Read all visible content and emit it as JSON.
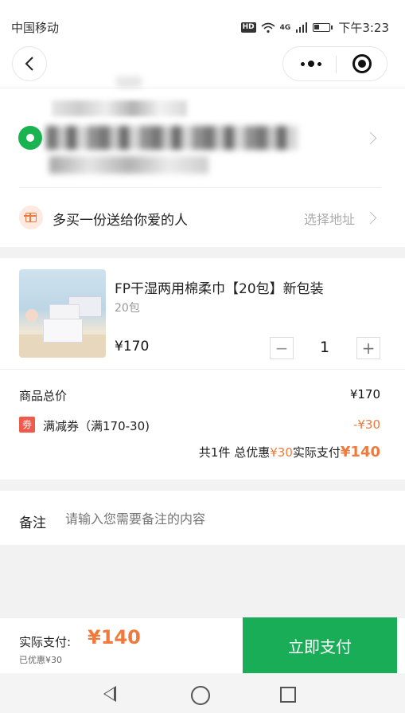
{
  "status_bar": {
    "carrier": "中国移动",
    "network": "4G",
    "hd": "HD",
    "time": "下午3:23"
  },
  "nav": {
    "back_icon": "chevron-left-icon",
    "more_icon": "more-dots-icon",
    "close_icon": "target-circle-icon"
  },
  "address": {
    "icon": "location-pin-icon",
    "color": "#19b350"
  },
  "gift": {
    "icon": "gift-icon",
    "text": "多买一份送给你爱的人",
    "action": "选择地址"
  },
  "product": {
    "title": "FP干湿两用棉柔巾【20包】新包装",
    "spec": "20包",
    "price": "¥170",
    "quantity": "1",
    "minus": "−",
    "plus": "+"
  },
  "totals": {
    "goods_label": "商品总价",
    "goods_value": "¥170",
    "coupon_badge": "劵",
    "coupon_label": "满减券（满170-30)",
    "coupon_value": "-¥30",
    "summary_prefix": "共1件 总优惠 ",
    "summary_discount": "¥30",
    "summary_mid": " 实际支付",
    "summary_total": "¥140"
  },
  "note": {
    "label": "备注",
    "placeholder": "请输入您需要备注的内容"
  },
  "footer": {
    "pay_label": "实际支付:",
    "pay_amount": "¥140",
    "saved": "已优惠¥30",
    "pay_button": "立即支付",
    "accent": "#f07a3c",
    "button_color": "#1aad57"
  },
  "system_nav": {
    "back": "triangle-back-icon",
    "home": "circle-home-icon",
    "recent": "square-recent-icon"
  }
}
